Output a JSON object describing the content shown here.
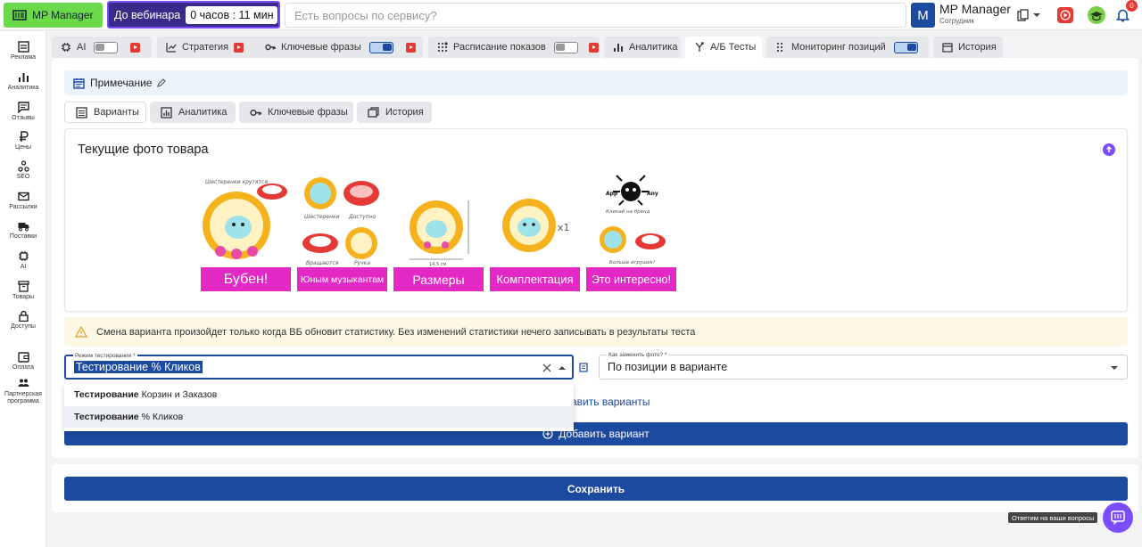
{
  "header": {
    "logo": "MP Manager",
    "webinar_label": "До вебинара",
    "webinar_timer": "0 часов : 11 мин",
    "search_placeholder": "Есть вопросы по сервису?",
    "avatar_letter": "M",
    "user_name": "MP Manager",
    "user_role": "Сотрудник",
    "notifications": "0"
  },
  "sidebar": {
    "items": [
      {
        "label": "Реклама",
        "icon": "ads-icon"
      },
      {
        "label": "Аналитика",
        "icon": "chart-icon"
      },
      {
        "label": "Отзывы",
        "icon": "comment-icon"
      },
      {
        "label": "Цены",
        "icon": "ruble-icon"
      },
      {
        "label": "SEO",
        "icon": "seo-icon"
      },
      {
        "label": "Рассылки",
        "icon": "mail-icon"
      },
      {
        "label": "Поставки",
        "icon": "truck-icon"
      },
      {
        "label": "AI",
        "icon": "chip-icon"
      },
      {
        "label": "Товары",
        "icon": "box-icon"
      },
      {
        "label": "Доступы",
        "icon": "lock-icon"
      },
      {
        "label": "Оплата",
        "icon": "wallet-icon"
      },
      {
        "label": "Партнерская программа",
        "icon": "partners-icon"
      }
    ]
  },
  "tabs": [
    {
      "label": "AI",
      "toggle": false,
      "video": true
    },
    {
      "label": "Стратегия",
      "toggle": null,
      "video": true
    },
    {
      "label": "Ключевые фразы",
      "toggle": true,
      "video": true
    },
    {
      "label": "Расписание показов",
      "toggle": false,
      "video": true
    },
    {
      "label": "Аналитика",
      "toggle": null,
      "video": false
    },
    {
      "label": "А/Б Тесты",
      "toggle": null,
      "video": false,
      "active": true
    },
    {
      "label": "Мониторинг позиций",
      "toggle": true,
      "video": false
    },
    {
      "label": "История",
      "toggle": null,
      "video": false
    }
  ],
  "note": {
    "label": "Примечание"
  },
  "subtabs": [
    {
      "label": "Варианты",
      "active": true
    },
    {
      "label": "Аналитика"
    },
    {
      "label": "Ключевые фразы"
    },
    {
      "label": "История"
    }
  ],
  "photos": {
    "title": "Текущие фото товара",
    "items": [
      {
        "caption": "Бубен!",
        "top_text": "Шестеренки крутятся"
      },
      {
        "caption": "Юным музыкантам",
        "top_text": "Шестеренки  Доступно"
      },
      {
        "caption": "Размеры",
        "top_text": "14,5 см"
      },
      {
        "caption": "Комплектация",
        "top_text": "x1"
      },
      {
        "caption": "Это интересно!",
        "top_text": "Кликай на бренд"
      }
    ],
    "brand_left": "App",
    "brand_right": "Any",
    "thumb2_labels": [
      "Шестеренки",
      "Доступно",
      "Вращаются",
      "Ручка"
    ],
    "thumb5_bottom": "Больше игрушек!"
  },
  "warning": "Смена варианта произойдет только когда ВБ обновит статистику. Без изменений статистики нечего записывать в результаты теста",
  "mode_field": {
    "label": "Режим тестирования *",
    "value": "Тестирование % Кликов"
  },
  "replace_field": {
    "label": "Как заменить фото? *",
    "value": "По позиции в варианте"
  },
  "dropdown": [
    {
      "bold": "Тестирование",
      "rest": "Корзин и Заказов"
    },
    {
      "bold": "Тестирование",
      "rest": "% Кликов",
      "selected": true
    }
  ],
  "add_variants_link": "авить варианты",
  "add_variant_button": "Добавить вариант",
  "save_button": "Сохранить",
  "help_tip": "Ответим на ваши вопросы",
  "colors": {
    "primary": "#1c4aa0",
    "accent": "#7c4dff",
    "caption": "#e328c6",
    "logo_bg": "#6bd94a"
  }
}
